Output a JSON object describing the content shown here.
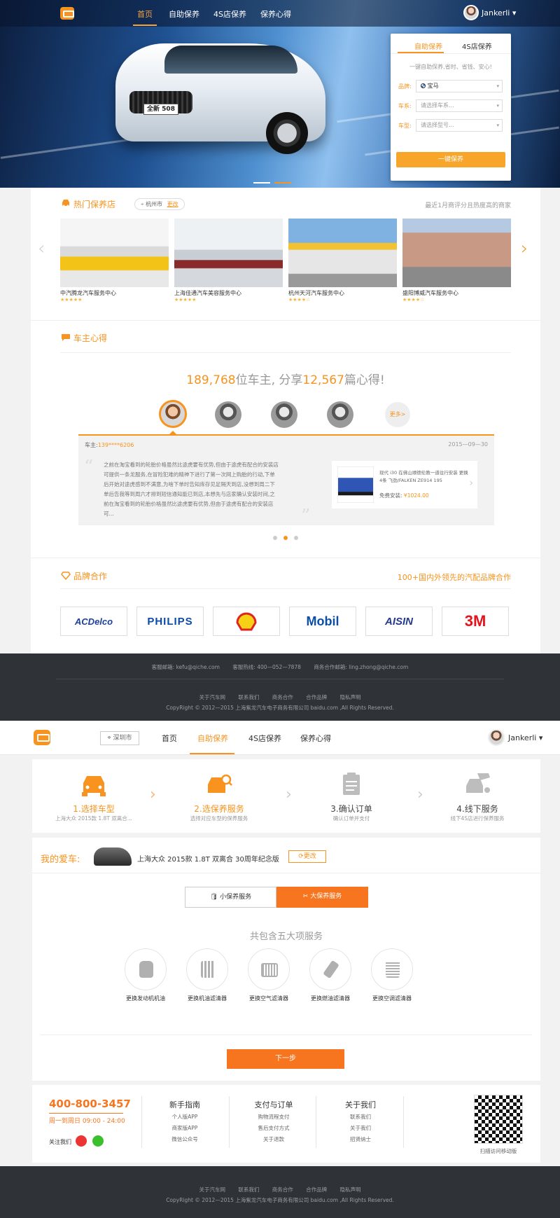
{
  "page1": {
    "nav": {
      "items": [
        "首页",
        "自助保养",
        "4S店保养",
        "保养心得"
      ],
      "active_index": 0,
      "user": "Jankerli"
    },
    "hero": {
      "plate_text": "全新 508"
    },
    "quick_card": {
      "tabs": [
        "自助保养",
        "4S店保养"
      ],
      "subtitle": "一键自助保养,省时、省钱、安心!",
      "brand_label": "品牌:",
      "brand_value": "宝马",
      "series_label": "车系:",
      "series_placeholder": "请选择车系...",
      "model_label": "车型:",
      "model_placeholder": "请选择型号...",
      "button": "一键保养"
    },
    "hot_stores": {
      "title": "热门保养店",
      "city": "杭州市",
      "change": "更改",
      "note": "最近1月商评分且热度高的商家",
      "items": [
        {
          "name": "中汽腾龙汽车服务中心",
          "stars": "★★★★★"
        },
        {
          "name": "上海佳通汽车美容服务中心",
          "stars": "★★★★★"
        },
        {
          "name": "杭州天河汽车服务中心",
          "stars": "★★★★☆"
        },
        {
          "name": "盛阳博威汽车服务中心",
          "stars": "★★★★☆"
        }
      ]
    },
    "owner_notes": {
      "title": "车主心得",
      "stat_owners": "189,768",
      "stat_owners_suffix": "位车主,",
      "stat_share": "分享",
      "stat_notes": "12,567",
      "stat_notes_suffix": "篇心得!",
      "more": "更多>",
      "owner_label": "车主:",
      "owner_phone": "139****6206",
      "date": "2015—09—30",
      "quote": "之前在淘宝看到的轮胎价格虽然比途虎要有优势,但由于途虎有配合的安装店可提供一条龙服务,在冒险犯难的精神下进行了第一次网上购胎的行动,下单后开始对途虎感到不满意,为啥下单时告知库存见足隔天到店,没想到周二下单后告我等到周六才排到短信通知能已到店,本想先与店家确认安装时间,之前在淘宝看到的轮胎价格虽然比途虎要有优势,但由于途虎有配合的安装店可...",
      "product_desc": "现代 i30 在佛山顺德伦教一道往行安装 更换4条 飞劲/FALKEN ZE914 195",
      "price_label": "免费安装:",
      "price": "¥1024.00"
    },
    "brands": {
      "title": "品牌合作",
      "note": "100+国内外领先的汽配品牌合作",
      "items": [
        "ACDelco",
        "PHILIPS",
        "Shell",
        "Mobil",
        "AISIN",
        "3M"
      ]
    },
    "footer": {
      "contacts": [
        "客服邮箱: kefu@qiche.com",
        "客服热线: 400—052—7878",
        "商务合作邮箱: ling.zhong@qiche.com"
      ],
      "links": [
        "关于汽车网",
        "联系我们",
        "商务合作",
        "合作品牌",
        "隐私声明"
      ],
      "copyright": "CopyRight © 2012—2015 上海紫龙汽车电子商务有限公司 baidu.com ,All Rights Reserved."
    }
  },
  "page2": {
    "nav": {
      "city": "深圳市",
      "items": [
        "首页",
        "自助保养",
        "4S店保养",
        "保养心得"
      ],
      "active_index": 1,
      "user": "Jankerli"
    },
    "steps": [
      {
        "title": "1.选择车型",
        "desc": "上海大众 2015款 1.8T 双离合..."
      },
      {
        "title": "2.选保养服务",
        "desc": "选择对应车型的保养服务"
      },
      {
        "title": "3.确认订单",
        "desc": "确认订单并支付"
      },
      {
        "title": "4.线下服务",
        "desc": "线下4S店进行保养服务"
      }
    ],
    "my_car": {
      "label": "我的爱车:",
      "value": "上海大众  2015款 1.8T 双离合 30周年纪念版",
      "change": "更改"
    },
    "service_tabs": [
      "小保养服务",
      "大保养服务"
    ],
    "five_title": "共包含五大项服务",
    "services": [
      "更换发动机机油",
      "更换机油滤清器",
      "更换空气滤清器",
      "更换燃油滤清器",
      "更换空调滤清器"
    ],
    "next": "下一步",
    "footer": {
      "hotline": "400-800-3457",
      "hours": "周一到周日  09:00 - 24:00",
      "follow": "关注我们",
      "cols": [
        {
          "title": "新手指南",
          "items": [
            "个人版APP",
            "商家版APP",
            "微信公众号"
          ]
        },
        {
          "title": "支付与订单",
          "items": [
            "购物流程支付",
            "售后支付方式",
            "关于退款"
          ]
        },
        {
          "title": "关于我们",
          "items": [
            "联系我们",
            "关于我们",
            "招贤纳士"
          ]
        }
      ],
      "qr_caption": "扫描访问移动版",
      "links": [
        "关于汽车网",
        "联系我们",
        "商务合作",
        "合作品牌",
        "隐私声明"
      ],
      "copyright": "CopyRight © 2012—2015 上海紫龙汽车电子商务有限公司 baidu.com ,All Rights Reserved."
    }
  }
}
